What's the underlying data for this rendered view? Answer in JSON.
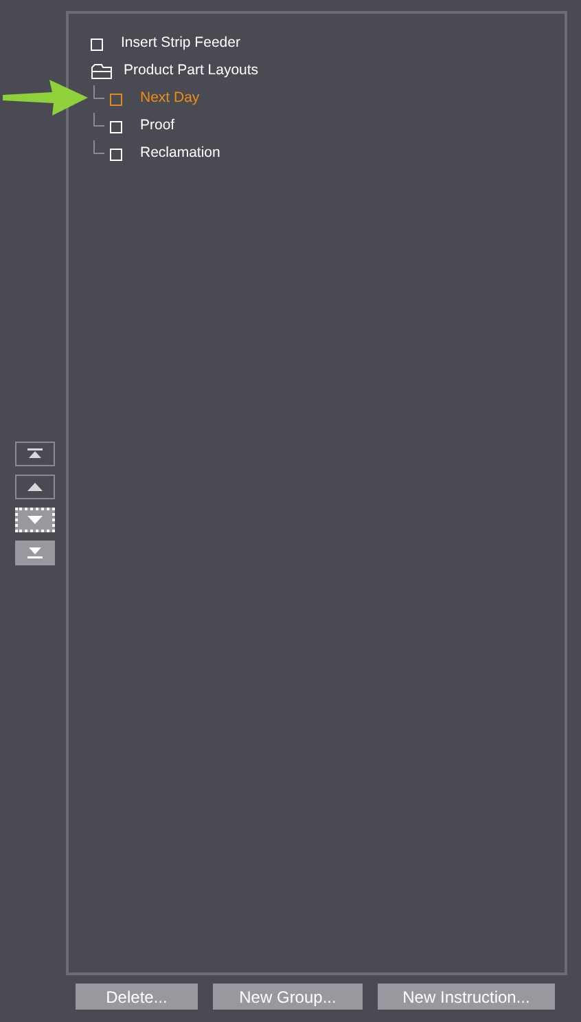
{
  "tree": [
    {
      "label": "Insert Strip Feeder",
      "kind": "item",
      "selected": false
    },
    {
      "label": "Product Part Layouts",
      "kind": "group",
      "expanded": true,
      "children": [
        {
          "label": "Next Day",
          "kind": "item",
          "selected": true
        },
        {
          "label": "Proof",
          "kind": "item",
          "selected": false
        },
        {
          "label": "Reclamation",
          "kind": "item",
          "selected": false
        }
      ]
    }
  ],
  "move_buttons": [
    {
      "kind": "top",
      "disabled": true,
      "focused": false
    },
    {
      "kind": "up",
      "disabled": true,
      "focused": false
    },
    {
      "kind": "down",
      "disabled": false,
      "focused": true
    },
    {
      "kind": "bottom",
      "disabled": false,
      "focused": false
    }
  ],
  "buttons": [
    "Delete...",
    "New Group...",
    "New Instruction..."
  ]
}
